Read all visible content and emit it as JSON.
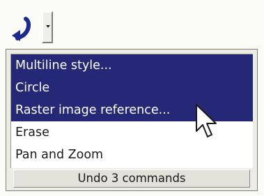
{
  "toolbar": {
    "undo_icon": "undo-arrow-icon",
    "dropdown_icon": "chevron-down-icon"
  },
  "undo_list": {
    "items": [
      {
        "label": "Multiline style...",
        "selected": true
      },
      {
        "label": "Circle",
        "selected": true
      },
      {
        "label": "Raster image reference...",
        "selected": true
      },
      {
        "label": "Erase",
        "selected": false
      },
      {
        "label": "Pan and Zoom",
        "selected": false
      }
    ],
    "status_text": "Undo 3 commands"
  },
  "colors": {
    "selection": "#252876",
    "undo_icon": "#1c2a8c"
  },
  "cursor_icon": "arrow-pointer-icon"
}
